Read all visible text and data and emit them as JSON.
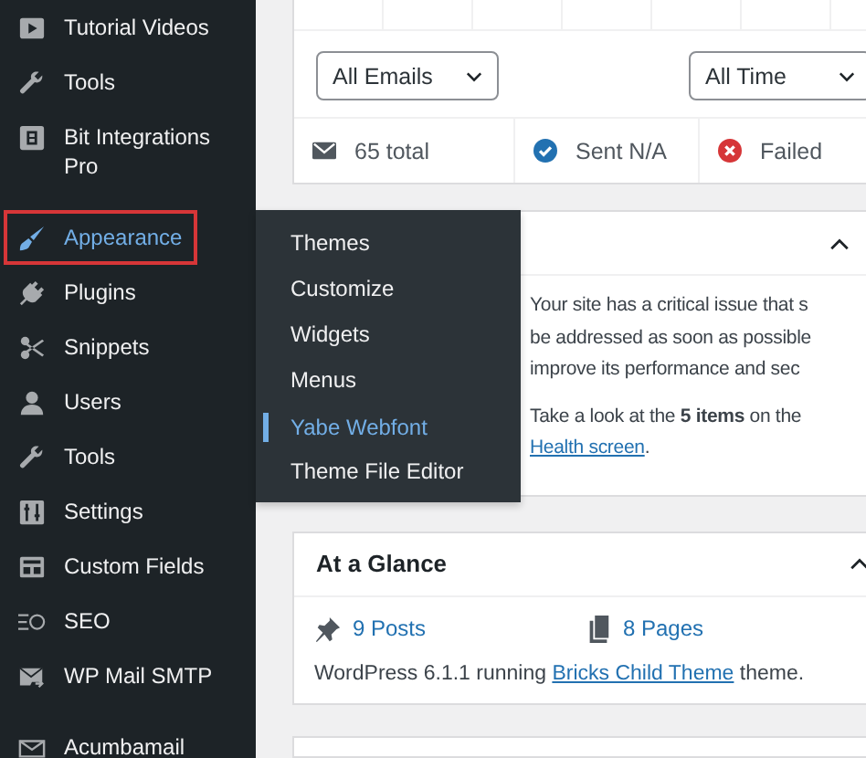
{
  "sidebar": {
    "groups": [
      {
        "items": [
          {
            "label": "Tutorial Videos",
            "selected": false
          },
          {
            "label": "Tools",
            "selected": false
          },
          {
            "label": "Bit Integrations Pro",
            "selected": false
          }
        ]
      },
      {
        "items": [
          {
            "label": "Appearance",
            "selected": true
          },
          {
            "label": "Plugins",
            "selected": false
          },
          {
            "label": "Snippets",
            "selected": false
          },
          {
            "label": "Users",
            "selected": false
          },
          {
            "label": "Tools",
            "selected": false
          },
          {
            "label": "Settings",
            "selected": false
          },
          {
            "label": "Custom Fields",
            "selected": false
          },
          {
            "label": "SEO",
            "selected": false
          },
          {
            "label": "WP Mail SMTP",
            "selected": false
          }
        ]
      },
      {
        "items": [
          {
            "label": "Acumbamail",
            "selected": false
          }
        ]
      }
    ]
  },
  "submenu": {
    "items": [
      {
        "label": "Themes",
        "selected": false
      },
      {
        "label": "Customize",
        "selected": false
      },
      {
        "label": "Widgets",
        "selected": false
      },
      {
        "label": "Menus",
        "selected": false
      },
      {
        "label": "Yabe Webfont",
        "selected": true
      },
      {
        "label": "Theme File Editor",
        "selected": false
      }
    ]
  },
  "email_log": {
    "filters": [
      {
        "value": "All Emails"
      },
      {
        "value": "All Time"
      }
    ],
    "stats": [
      {
        "kind": "total",
        "label": "65 total"
      },
      {
        "kind": "sent",
        "label": "Sent N/A"
      },
      {
        "kind": "failed",
        "label": "Failed"
      }
    ]
  },
  "site_health": {
    "lines": [
      "Your site has a critical issue that s",
      "be addressed as soon as possible",
      "improve its performance and sec"
    ],
    "prompt": "Take a look at the **5 items** on the",
    "link": "Health screen",
    "after": "."
  },
  "at_a_glance": {
    "title": "At a Glance",
    "counts": [
      {
        "kind": "posts",
        "label": "9 Posts"
      },
      {
        "kind": "pages",
        "label": "8 Pages"
      }
    ],
    "footer": {
      "before": "WordPress 6.1.1 running ",
      "link": "Bricks Child Theme",
      "after": " theme."
    }
  }
}
